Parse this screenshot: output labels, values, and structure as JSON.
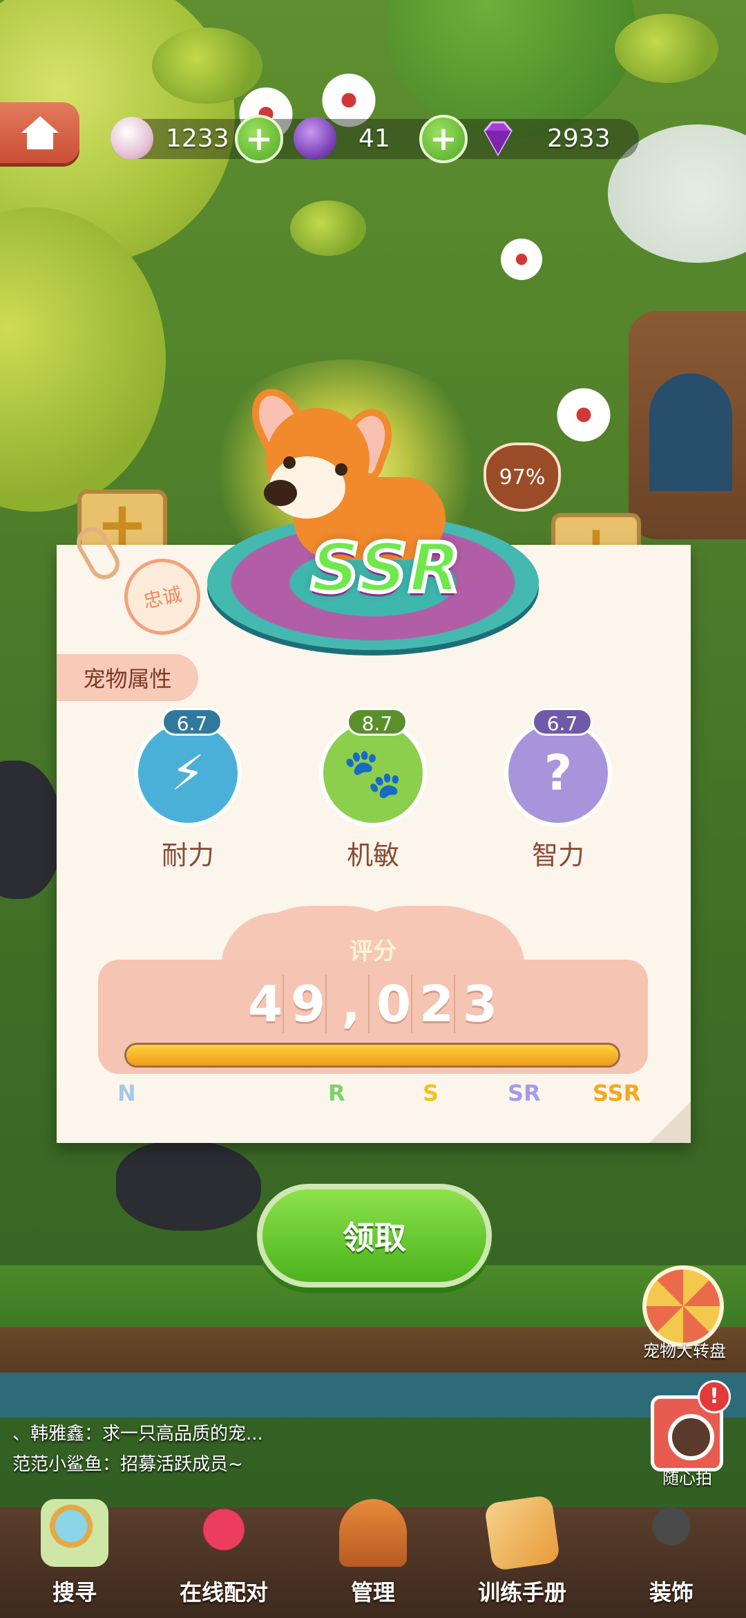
{
  "currencies": [
    {
      "name": "bottle-coin",
      "value": "1233"
    },
    {
      "name": "potion-coin",
      "value": "41"
    },
    {
      "name": "gem",
      "value": "2933"
    }
  ],
  "pet": {
    "rarity": "SSR",
    "loyalty_stamp": "忠诚",
    "percent": "97%",
    "section_title": "宠物属性"
  },
  "stats": [
    {
      "label": "耐力",
      "score": "6.7",
      "color": "#4bb0d8",
      "icon": "endurance-icon"
    },
    {
      "label": "机敏",
      "score": "8.7",
      "color": "#8ccf4d",
      "icon": "agility-icon"
    },
    {
      "label": "智力",
      "score": "6.7",
      "color": "#a894db",
      "icon": "intelligence-icon"
    }
  ],
  "score": {
    "label": "评分",
    "digits": [
      "4",
      "9",
      ",",
      "0",
      "2",
      "3"
    ],
    "progress": 1.0,
    "tiers": [
      {
        "label": "N",
        "color": "#a7c8e8"
      },
      {
        "label": "R",
        "color": "#7bd36a"
      },
      {
        "label": "S",
        "color": "#f2c21b"
      },
      {
        "label": "SR",
        "color": "#a59ce8"
      },
      {
        "label": "SSR",
        "color": "#f5a81a"
      }
    ]
  },
  "claim_button": "领取",
  "side_widgets": {
    "wheel_label": "宠物大转盘",
    "camera_label": "随心拍",
    "notification": "!"
  },
  "chat": [
    "、韩雅鑫：求一只高品质的宠...",
    "范范小鲨鱼：招募活跃成员~"
  ],
  "nav": [
    {
      "label": "搜寻",
      "icon": "magnifier-icon"
    },
    {
      "label": "在线配对",
      "icon": "heart-icon"
    },
    {
      "label": "管理",
      "icon": "house-icon"
    },
    {
      "label": "训练手册",
      "icon": "book-icon"
    },
    {
      "label": "装饰",
      "icon": "tree-icon"
    }
  ]
}
